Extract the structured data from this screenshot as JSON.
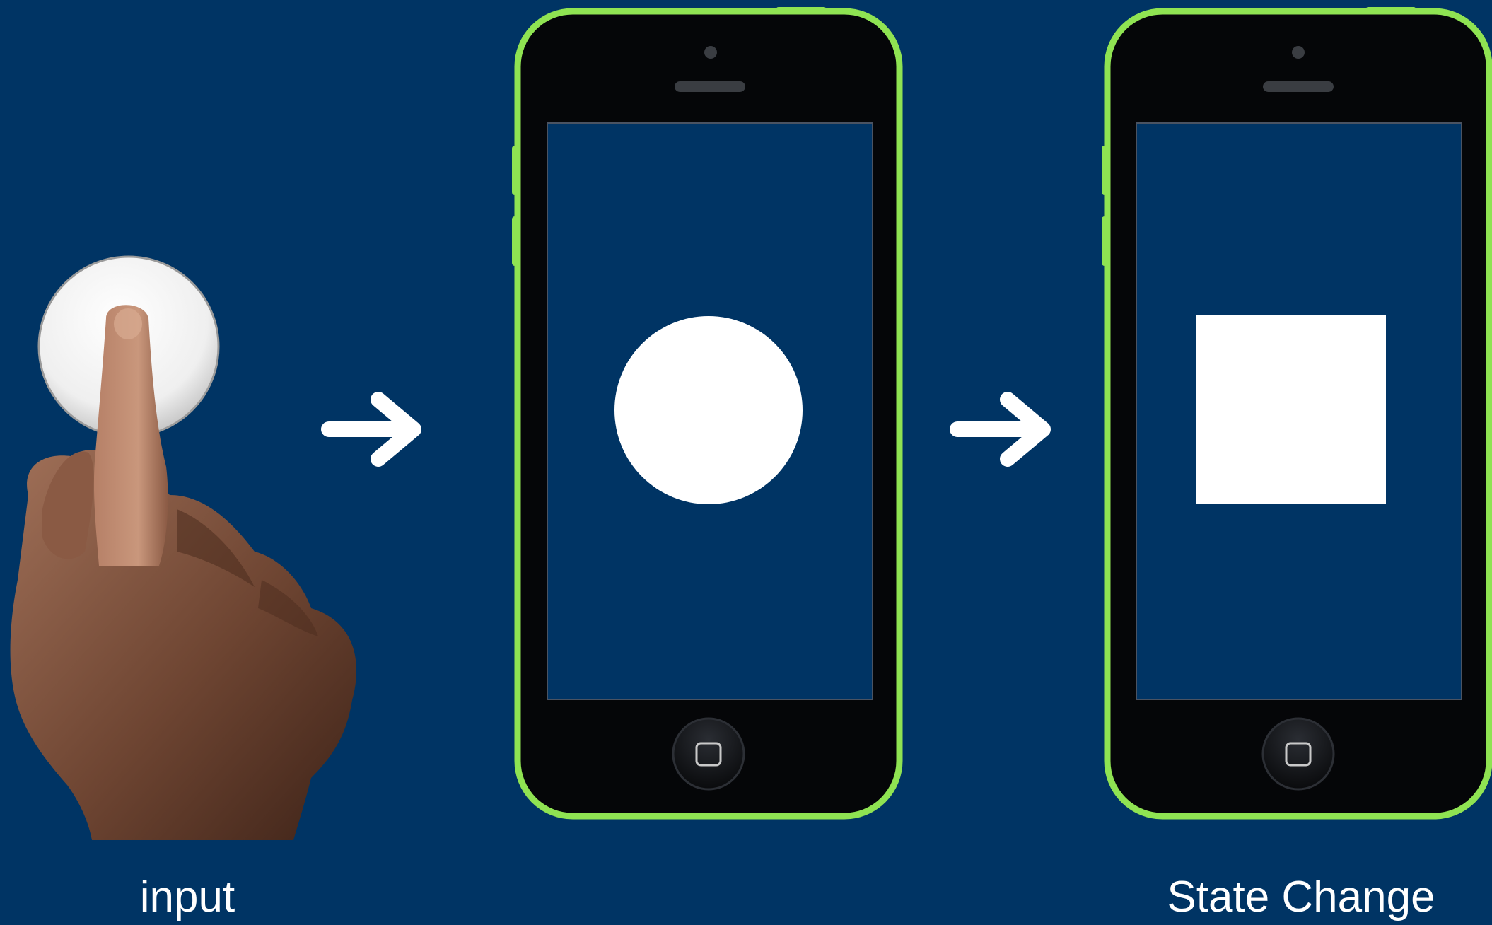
{
  "labels": {
    "input": "input",
    "state_change": "State Change"
  },
  "colors": {
    "background": "#003464",
    "phone_bezel": "#050608",
    "phone_frame": "#8fe352",
    "screen": "#003464",
    "shape": "#ffffff",
    "arrow": "#ffffff",
    "button_surface": "#efefef"
  },
  "icons": {
    "touch": "hand-tapping-button-icon",
    "transition": "right-arrow-icon",
    "home_button": "home-button-icon",
    "shape_before": "circle-icon",
    "shape_after": "square-icon"
  }
}
